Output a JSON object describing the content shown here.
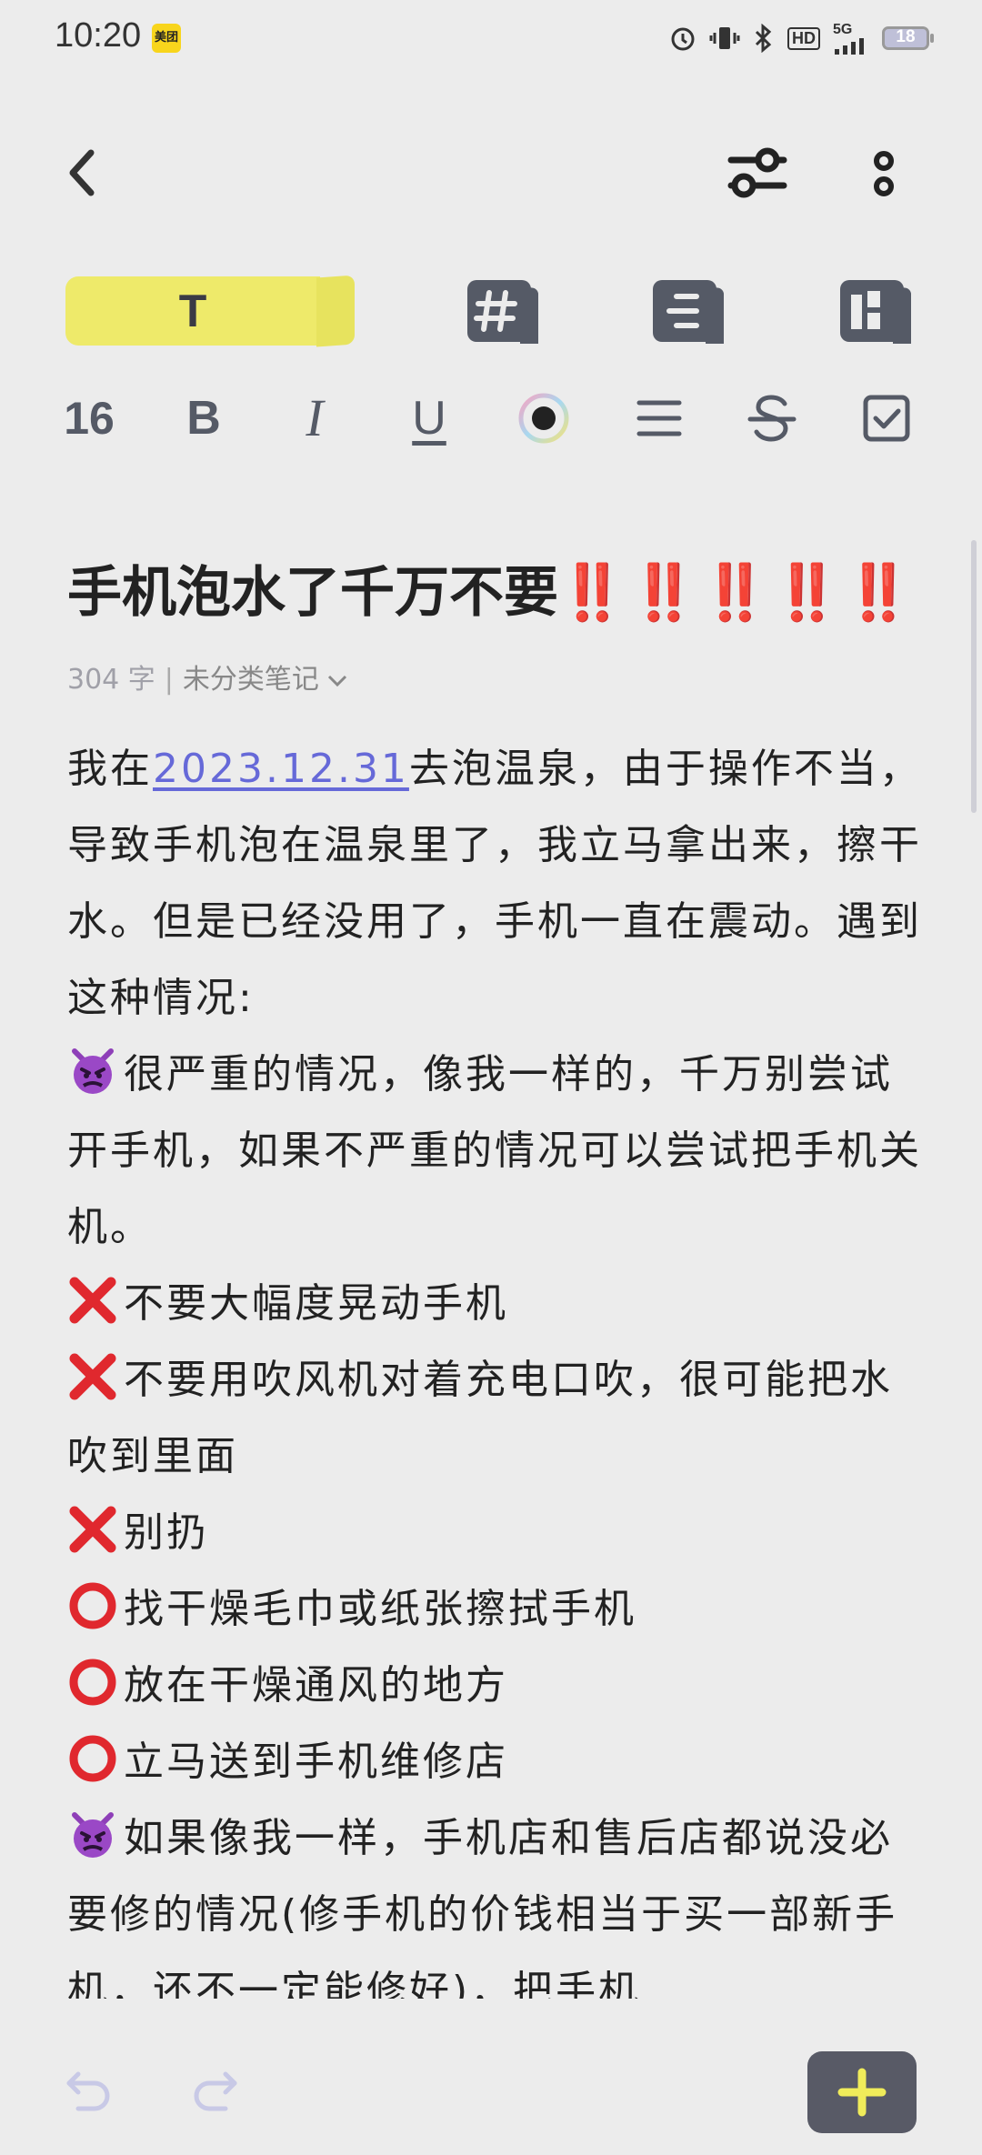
{
  "status_bar": {
    "time": "10:20",
    "app_badge": "美团",
    "network": "5G",
    "hd": "HD",
    "battery": "18"
  },
  "format_row": {
    "font_size": "16",
    "bold": "B",
    "italic": "I",
    "underline": "U"
  },
  "tabs": {
    "text_tab": "T"
  },
  "note": {
    "title": "手机泡水了千万不要",
    "title_marks": "‼️‼️‼️‼️‼️",
    "word_count": "304 字",
    "separator": "|",
    "category": "未分类笔记",
    "p1_before": "我在",
    "p1_date": "2023.12.31",
    "p1_after": "去泡温泉，由于操作不当，导致手机泡在温泉里了，我立马拿出来，擦干水。但是已经没用了，手机一直在震动。遇到这种情况:",
    "p2": "很严重的情况，像我一样的，千万别尝试开手机，如果不严重的情况可以尝试把手机关机。",
    "p3": "不要大幅度晃动手机",
    "p4": "不要用吹风机对着充电口吹，很可能把水吹到里面",
    "p5": "别扔",
    "p6": "找干燥毛巾或纸张擦拭手机",
    "p7": "放在干燥通风的地方",
    "p8": "立马送到手机维修店",
    "p9": "如果像我一样，手机店和售后店都说没必要修的情况(修手机的价钱相当于买一部新手机，还不一定能修好)，把手机"
  },
  "colors": {
    "highlight": "#eeea6a",
    "link": "#6669d8",
    "alert": "#d8283a",
    "add_button": "#585a66",
    "add_icon": "#f0ec5a"
  }
}
